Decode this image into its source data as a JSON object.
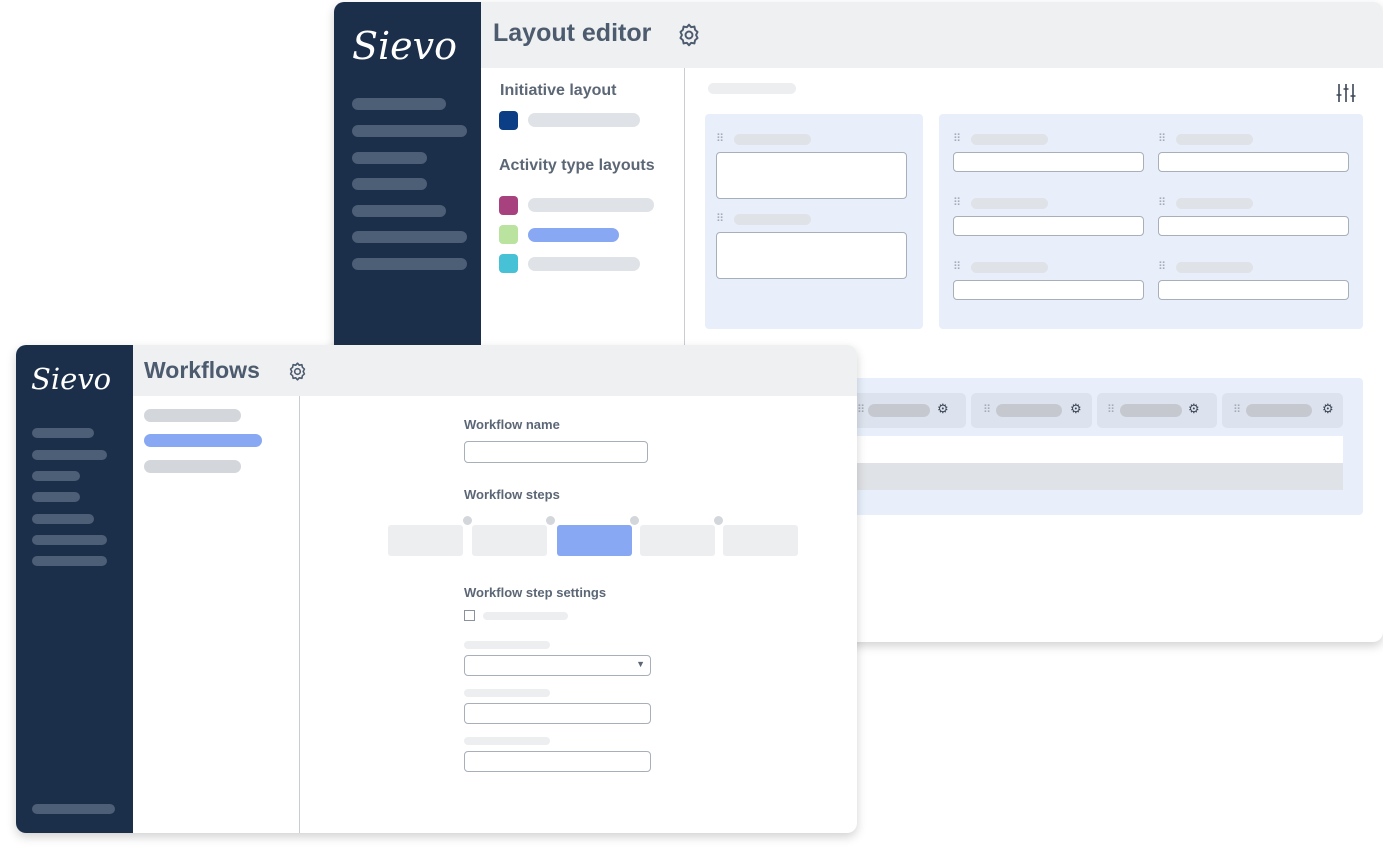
{
  "brand": {
    "name": "Sievo"
  },
  "layout_editor": {
    "title": "Layout editor",
    "settings_icon": "gear-icon",
    "filter_icon": "sliders-icon",
    "initiative_layout_label": "Initiative layout",
    "activity_type_layouts_label": "Activity type layouts",
    "colors": {
      "initiative": "#0b3e84",
      "activity_1": "#a8427e",
      "activity_2": "#b9e39e",
      "activity_3": "#46c1d6"
    }
  },
  "workflows": {
    "title": "Workflows",
    "settings_icon": "gear-icon",
    "workflow_name_label": "Workflow name",
    "workflow_steps_label": "Workflow steps",
    "workflow_step_settings_label": "Workflow step settings",
    "dropdown_icon": "caret-down-icon"
  },
  "colors": {
    "sidebar": "#1c2f4a",
    "accent": "#88a8f4",
    "panel": "#e8effb"
  }
}
